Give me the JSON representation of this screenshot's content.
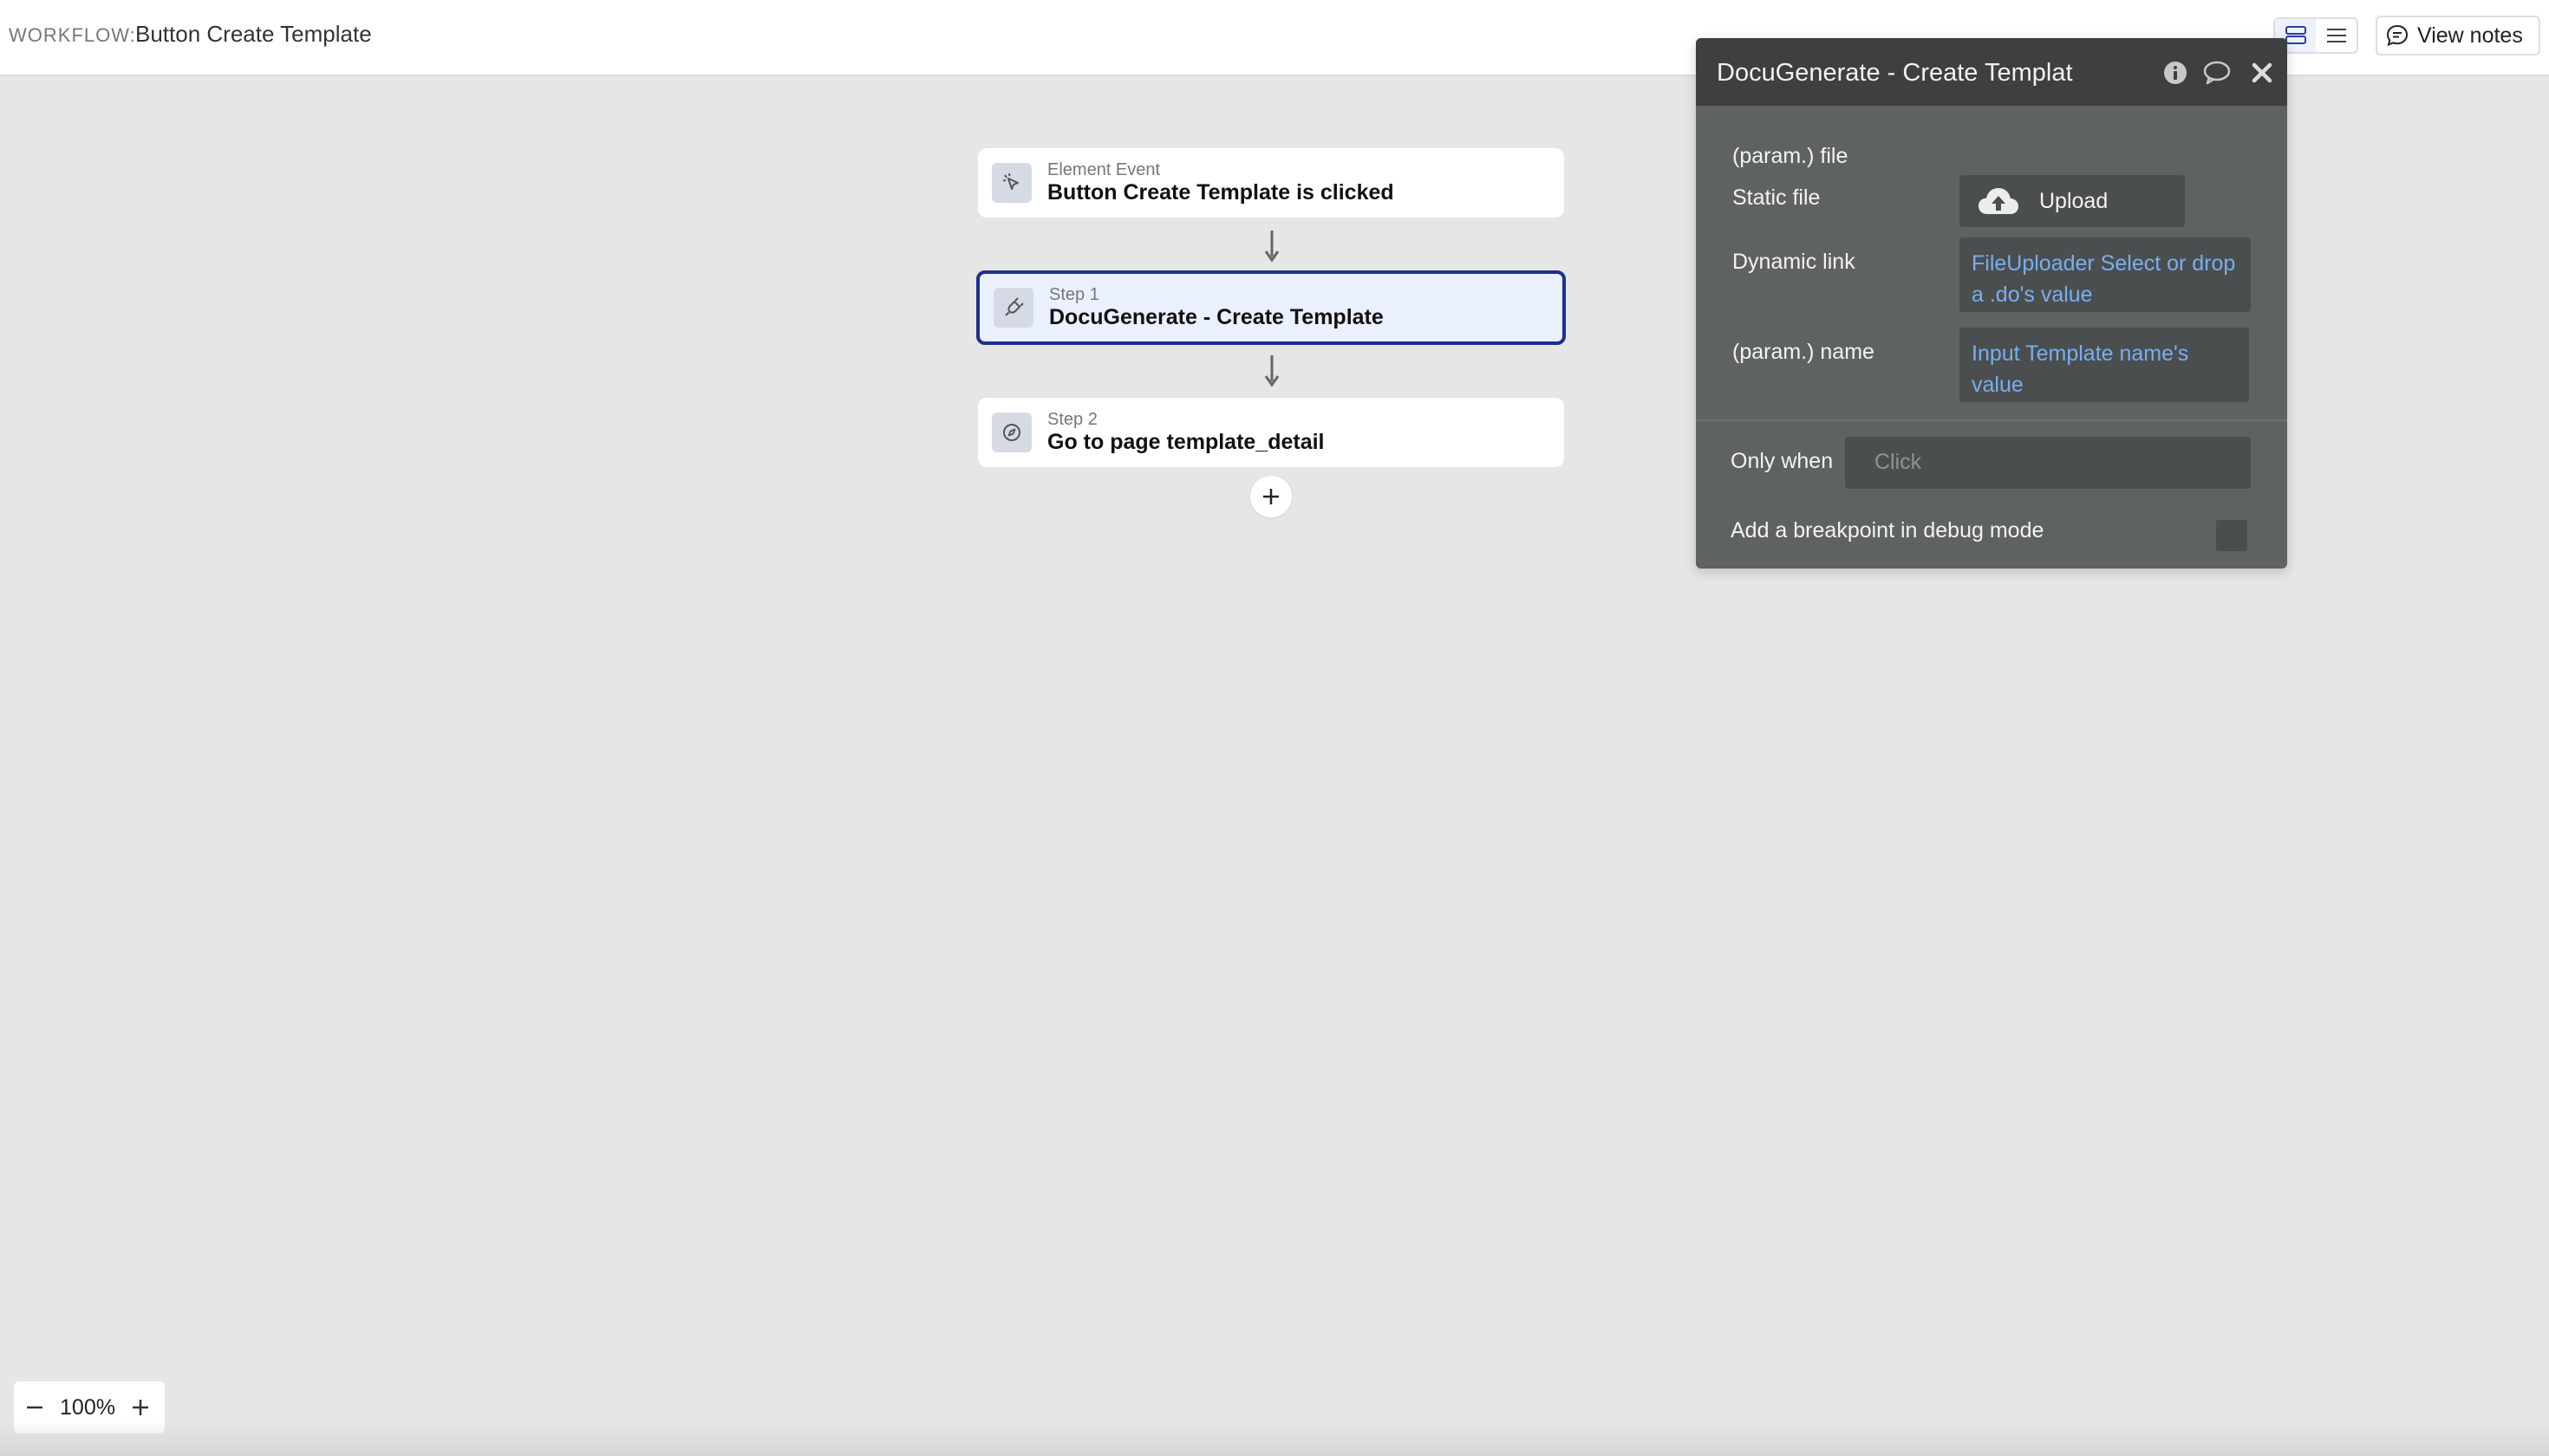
{
  "topbar": {
    "workflow_label": "WORKFLOW:",
    "workflow_name": "Button Create Template",
    "view_notes_label": "View notes"
  },
  "canvas": {
    "event": {
      "subtitle": "Element Event",
      "title": "Button Create Template is clicked",
      "icon": "cursor-click-icon"
    },
    "steps": [
      {
        "subtitle": "Step 1",
        "title": "DocuGenerate - Create Template",
        "icon": "plugin-plug-icon",
        "selected": true
      },
      {
        "subtitle": "Step 2",
        "title": "Go to page template_detail",
        "icon": "navigate-compass-icon",
        "selected": false
      }
    ]
  },
  "panel": {
    "title": "DocuGenerate - Create Templat",
    "file_param_label": "(param.) file",
    "static_file_label": "Static file",
    "upload_label": "Upload",
    "dynamic_link_label": "Dynamic link",
    "dynamic_link_value": "FileUploader Select or drop a .do's value",
    "name_param_label": "(param.) name",
    "name_param_value": "Input Template name's value",
    "only_when_label": "Only when",
    "only_when_placeholder": "Click",
    "breakpoint_label": "Add a breakpoint in debug mode"
  },
  "zoom": {
    "value": "100%"
  },
  "colors": {
    "selected_border": "#1d2f8f",
    "selected_bg": "#eaf0fd",
    "panel_bg": "#5f6263",
    "panel_header": "#3d3f40",
    "dynamic_text": "#78aef0"
  }
}
